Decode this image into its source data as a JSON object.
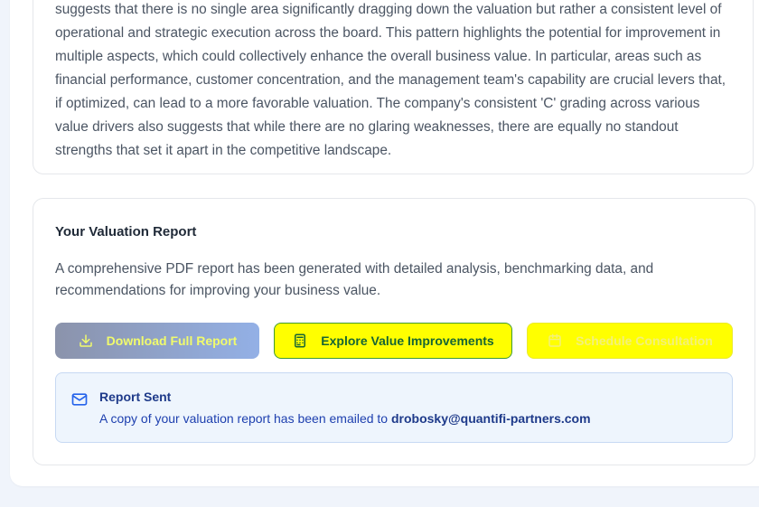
{
  "summary": {
    "text": "suggests that there is no single area significantly dragging down the valuation but rather a consistent level of operational and strategic execution across the board. This pattern highlights the potential for improvement in multiple aspects, which could collectively enhance the overall business value. In particular, areas such as financial performance, customer concentration, and the management team's capability are crucial levers that, if optimized, can lead to a more favorable valuation. The company's consistent 'C' grading across various value drivers also suggests that while there are no glaring weaknesses, there are equally no standout strengths that set it apart in the competitive landscape."
  },
  "report": {
    "title": "Your Valuation Report",
    "description": "A comprehensive PDF report has been generated with detailed analysis, benchmarking data, and recommendations for improving your business value.",
    "buttons": {
      "download": {
        "label": "Download Full Report",
        "icon": "download-icon"
      },
      "explore": {
        "label": "Explore Value Improvements",
        "icon": "calculator-icon"
      },
      "schedule": {
        "label": "Schedule Consultation",
        "icon": "calendar-icon"
      }
    },
    "notice": {
      "title": "Report Sent",
      "body_prefix": "A copy of your valuation report has been emailed to ",
      "email": "drobosky@quantifi-partners.com",
      "icon": "mail-icon"
    }
  },
  "colors": {
    "page_bg": "#f0f4fb",
    "explore_bg": "#ffff00",
    "schedule_bg": "#ffff00",
    "notice_bg": "#eef5fd",
    "notice_text": "#1e3a8a"
  }
}
